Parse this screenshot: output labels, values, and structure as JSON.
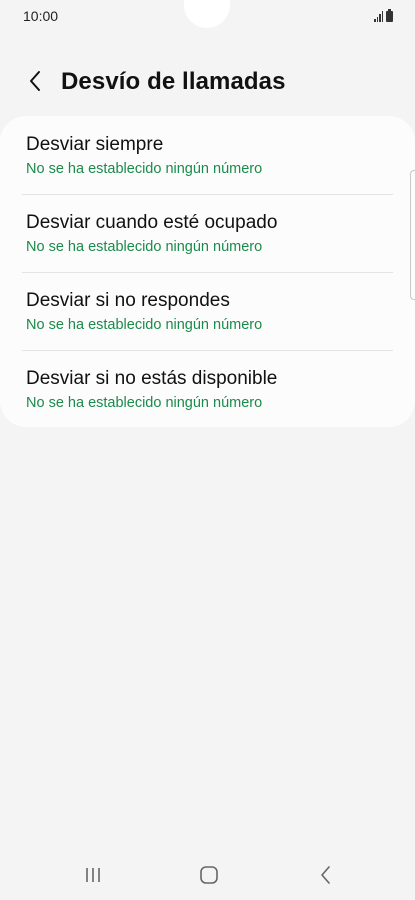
{
  "status_bar": {
    "time": "10:00",
    "icons": [
      "signal-icon",
      "battery-icon"
    ]
  },
  "header": {
    "title": "Desvío de llamadas",
    "back_icon": "chevron-left-icon"
  },
  "list": {
    "items": [
      {
        "title": "Desviar siempre",
        "subtitle": "No se ha establecido ningún número"
      },
      {
        "title": "Desviar cuando esté ocupado",
        "subtitle": "No se ha establecido ningún número"
      },
      {
        "title": "Desviar si no respondes",
        "subtitle": "No se ha establecido ningún número"
      },
      {
        "title": "Desviar si no estás disponible",
        "subtitle": "No se ha establecido ningún número"
      }
    ]
  },
  "nav_bar": {
    "icons": [
      "recent-apps-icon",
      "home-icon",
      "back-icon"
    ]
  },
  "colors": {
    "background": "#f4f4f4",
    "card": "#fcfcfc",
    "subtitle_green": "#1a8b4a"
  }
}
